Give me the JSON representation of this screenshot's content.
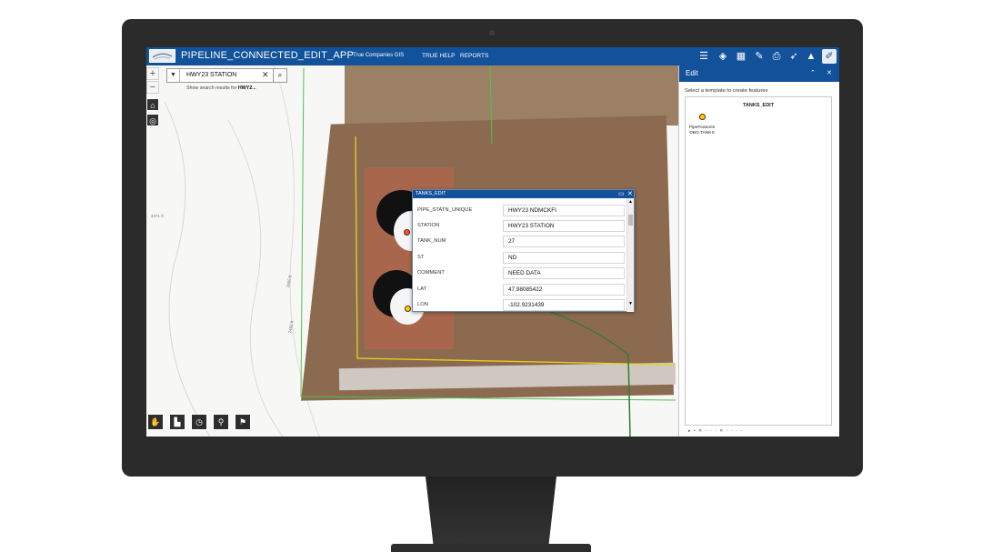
{
  "app": {
    "title": "PIPELINE_CONNECTED_EDIT_APP",
    "subtitle": "True Companies GIS",
    "links": [
      "TRUE HELP",
      "REPORTS"
    ],
    "toolbar_icons": [
      "list-icon",
      "layers-icon",
      "basemap-icon",
      "measure-icon",
      "print-icon",
      "directions-icon",
      "warning-icon",
      "edit-icon"
    ]
  },
  "map": {
    "zoom_in": "+",
    "zoom_out": "−",
    "search": {
      "value": "HWY23 STATION",
      "hint_prefix": "Show search results for",
      "hint_term": "HWY2..."
    },
    "contour_labels": [
      "2471 ft",
      "2465 ft",
      "2468 ft"
    ],
    "bottom_tools": [
      "select-icon",
      "data-icon",
      "dashboard-icon",
      "location-icon",
      "report-icon"
    ]
  },
  "popup": {
    "title": "TANKS_EDIT",
    "fields": [
      {
        "label": "PIPE_STATN_UNIQUE",
        "value": "HWY23 NDMCKFI"
      },
      {
        "label": "STATION",
        "value": "HWY23 STATION"
      },
      {
        "label": "TANK_NUM",
        "value": "27"
      },
      {
        "label": "ST",
        "value": "ND"
      },
      {
        "label": "COMMENT",
        "value": "NEED DATA"
      },
      {
        "label": "LAT",
        "value": "47.98085422"
      },
      {
        "label": "LON",
        "value": "-102.9231439"
      }
    ]
  },
  "edit_panel": {
    "title": "Edit",
    "hint": "Select a template to create features",
    "template_group": "TANKS_EDIT",
    "template_item": "PipeFeatures DBO.TANKS"
  },
  "colors": {
    "header": "#12529a",
    "marker": "#ffd200",
    "parcel_line": "#e6d21c",
    "boundary_line": "#4ec24e"
  }
}
